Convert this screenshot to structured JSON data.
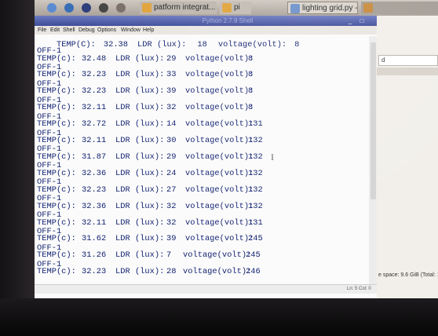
{
  "taskbar": {
    "tasks": [
      {
        "label": "patform integrat...",
        "color": "#e0a33a"
      },
      {
        "label": "pi",
        "color": "#e0a33a"
      },
      {
        "label": "lighting grid.py - /ho...",
        "color": "#6a8fc9"
      },
      {
        "label": "",
        "color": "#c7893a"
      }
    ]
  },
  "shell": {
    "title": "Python 2.7.9 Shell",
    "window_controls": "_ □ x",
    "menu": [
      "File",
      "Edit",
      "Shell",
      "Debug",
      "Options",
      "Window",
      "Help"
    ],
    "status": "Ln: 5  Col: 0"
  },
  "background_window": {
    "path_text": "d",
    "status_text": "e space: 9.6 GiB (Total: 1"
  },
  "console": {
    "first_partial": {
      "temp_label": "TEMP(C):",
      "temp": "32.38",
      "ldr_label": "LDR (lux):",
      "ldr": "18",
      "volt_label": "voltage(volt):",
      "volt": "8"
    },
    "off_label": "OFF-1",
    "rows": [
      {
        "temp_label": "TEMP(c):",
        "temp": "32.48",
        "ldr_label": "LDR (lux):",
        "ldr": "29",
        "volt_label": "voltage(volt):",
        "volt": "8"
      },
      {
        "temp_label": "TEMP(c):",
        "temp": "32.23",
        "ldr_label": "LDR (lux):",
        "ldr": "33",
        "volt_label": "voltage(volt):",
        "volt": "8"
      },
      {
        "temp_label": "TEMP(c):",
        "temp": "32.23",
        "ldr_label": "LDR (lux):",
        "ldr": "39",
        "volt_label": "voltage(volt):",
        "volt": "8"
      },
      {
        "temp_label": "TEMP(c):",
        "temp": "32.11",
        "ldr_label": "LDR (lux):",
        "ldr": "32",
        "volt_label": "voltage(volt):",
        "volt": "8"
      },
      {
        "temp_label": "TEMP(c):",
        "temp": "32.72",
        "ldr_label": "LDR (lux):",
        "ldr": "14",
        "volt_label": "voltage(volt):",
        "volt": "131"
      },
      {
        "temp_label": "TEMP(c):",
        "temp": "32.11",
        "ldr_label": "LDR (lux):",
        "ldr": "30",
        "volt_label": "voltage(volt):",
        "volt": "132"
      },
      {
        "temp_label": "TEMP(c):",
        "temp": "31.87",
        "ldr_label": "LDR (lux):",
        "ldr": "29",
        "volt_label": "voltage(volt):",
        "volt": "132"
      },
      {
        "temp_label": "TEMP(c):",
        "temp": "32.36",
        "ldr_label": "LDR (lux):",
        "ldr": "24",
        "volt_label": "voltage(volt):",
        "volt": "132"
      },
      {
        "temp_label": "TEMP(c):",
        "temp": "32.23",
        "ldr_label": "LDR (lux):",
        "ldr": "27",
        "volt_label": "voltage(volt):",
        "volt": "132"
      },
      {
        "temp_label": "TEMP(c):",
        "temp": "32.36",
        "ldr_label": "LDR (lux):",
        "ldr": "32",
        "volt_label": "voltage(volt):",
        "volt": "132"
      },
      {
        "temp_label": "TEMP(c):",
        "temp": "32.11",
        "ldr_label": "LDR (lux):",
        "ldr": "32",
        "volt_label": "voltage(volt):",
        "volt": "131"
      },
      {
        "temp_label": "TEMP(c):",
        "temp": "31.62",
        "ldr_label": "LDR (lux):",
        "ldr": "39",
        "volt_label": "voltage(volt):",
        "volt": "245"
      },
      {
        "temp_label": "TEMP(c):",
        "temp": "31.26",
        "ldr_label": "LDR (lux):",
        "ldr": "7",
        "volt_label": "voltage(volt):",
        "volt": "245"
      },
      {
        "temp_label": "TEMP(c):",
        "temp": "32.23",
        "ldr_label": "LDR (lux):",
        "ldr": "28",
        "volt_label": "voltage(volt):",
        "volt": "246"
      }
    ]
  }
}
